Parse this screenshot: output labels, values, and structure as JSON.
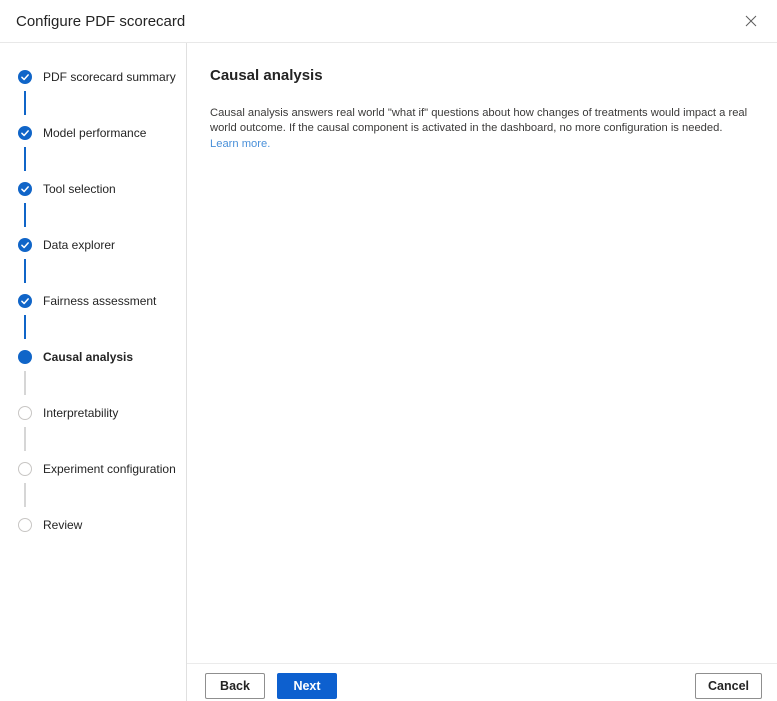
{
  "header": {
    "title": "Configure PDF scorecard"
  },
  "stepper": {
    "steps": [
      {
        "label": "PDF scorecard summary",
        "state": "completed"
      },
      {
        "label": "Model performance",
        "state": "completed"
      },
      {
        "label": "Tool selection",
        "state": "completed"
      },
      {
        "label": "Data explorer",
        "state": "completed"
      },
      {
        "label": "Fairness assessment",
        "state": "completed"
      },
      {
        "label": "Causal analysis",
        "state": "current"
      },
      {
        "label": "Interpretability",
        "state": "upcoming"
      },
      {
        "label": "Experiment configuration",
        "state": "upcoming"
      },
      {
        "label": "Review",
        "state": "upcoming"
      }
    ]
  },
  "content": {
    "heading": "Causal analysis",
    "description": "Causal analysis answers real world \"what if\" questions about how changes of treatments would impact a real world outcome. If the causal component is activated in the dashboard, no more configuration is needed.",
    "learn_more_label": "Learn more."
  },
  "footer": {
    "back_label": "Back",
    "next_label": "Next",
    "cancel_label": "Cancel"
  },
  "icons": {
    "close": "close-icon",
    "step_completed": "check-icon",
    "step_current": "filled-dot-icon",
    "step_upcoming": "empty-circle-icon"
  },
  "colors": {
    "accent_blue": "#0d60cf",
    "step_blue": "#1065c8",
    "link_blue": "#4a90d9",
    "connector_gray": "#d6d6d6",
    "upcoming_ring": "#c8c6c4",
    "divider": "#e8e8e8",
    "button_border": "#8f8f8f",
    "text_primary": "#242424",
    "close_icon_gray": "#5c5c5c"
  }
}
